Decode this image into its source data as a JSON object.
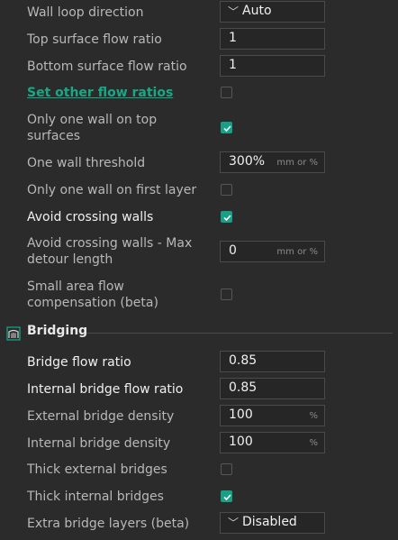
{
  "wall_loop_direction": {
    "label": "Wall loop direction",
    "value": "Auto"
  },
  "top_surface_flow_ratio": {
    "label": "Top surface flow ratio",
    "value": "1"
  },
  "bottom_surface_flow_ratio": {
    "label": "Bottom surface flow ratio",
    "value": "1"
  },
  "set_other_flow_ratios": {
    "label": "Set other flow ratios",
    "checked": false
  },
  "only_one_wall_top": {
    "label_line1": "Only one wall on top",
    "label_line2": "surfaces",
    "checked": true
  },
  "one_wall_threshold": {
    "label": "One wall threshold",
    "value": "300%",
    "unit": "mm or %"
  },
  "only_one_wall_first_layer": {
    "label": "Only one wall on first layer",
    "checked": false
  },
  "avoid_crossing_walls": {
    "label": "Avoid crossing walls",
    "checked": true
  },
  "avoid_crossing_max_detour": {
    "label_line1": "Avoid crossing walls - Max",
    "label_line2": "detour length",
    "value": "0",
    "unit": "mm or %"
  },
  "small_area_flow_comp": {
    "label_line1": "Small area flow",
    "label_line2": "compensation (beta)",
    "checked": false
  },
  "bridging_section": {
    "title": "Bridging",
    "icon": "bridge-icon"
  },
  "bridge_flow_ratio": {
    "label": "Bridge flow ratio",
    "value": "0.85"
  },
  "internal_bridge_flow_ratio": {
    "label": "Internal bridge flow ratio",
    "value": "0.85"
  },
  "external_bridge_density": {
    "label": "External bridge density",
    "value": "100",
    "unit": "%"
  },
  "internal_bridge_density": {
    "label": "Internal bridge density",
    "value": "100",
    "unit": "%"
  },
  "thick_external_bridges": {
    "label": "Thick external bridges",
    "checked": false
  },
  "thick_internal_bridges": {
    "label": "Thick internal bridges",
    "checked": true
  },
  "extra_bridge_layers": {
    "label": "Extra bridge layers (beta)",
    "value": "Disabled"
  },
  "colors": {
    "accent": "#17a085",
    "link": "#18a886",
    "background": "#2b2b2b"
  }
}
